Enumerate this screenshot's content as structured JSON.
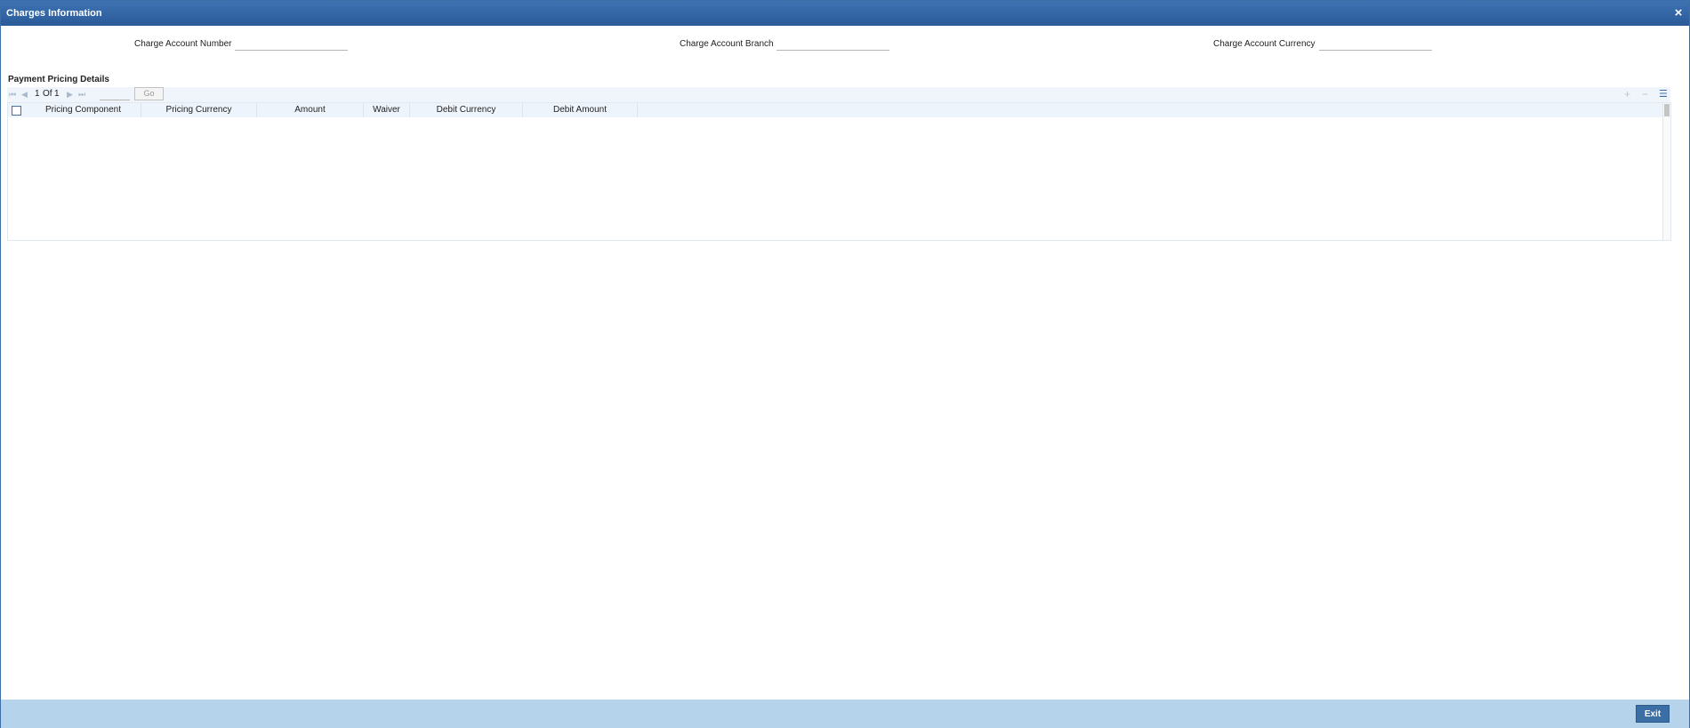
{
  "window": {
    "title": "Charges Information",
    "close_icon": "×"
  },
  "fields": {
    "charge_account_number": {
      "label": "Charge Account Number",
      "value": ""
    },
    "charge_account_branch": {
      "label": "Charge Account Branch",
      "value": ""
    },
    "charge_account_currency": {
      "label": "Charge Account Currency",
      "value": ""
    }
  },
  "pricing": {
    "section_title": "Payment Pricing Details",
    "pagination": {
      "current": "1",
      "of_label": "Of",
      "total": "1",
      "go_label": "Go",
      "page_input": ""
    },
    "toolbar_icons": {
      "add": "+",
      "remove": "−",
      "columns": "☰"
    },
    "columns": [
      "Pricing Component",
      "Pricing Currency",
      "Amount",
      "Waiver",
      "Debit Currency",
      "Debit Amount"
    ],
    "rows": []
  },
  "footer": {
    "exit_label": "Exit"
  },
  "colors": {
    "title_bar": "#2f62a2",
    "footer": "#b5d4ec",
    "exit_button": "#3a6ea5"
  }
}
